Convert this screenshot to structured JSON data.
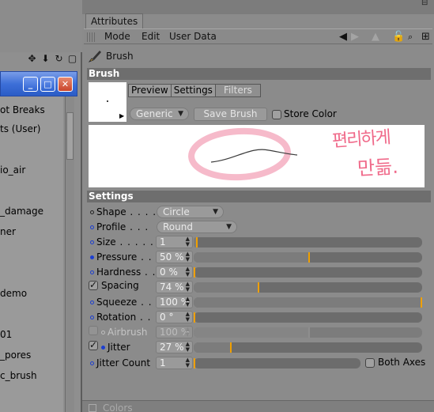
{
  "left_panel": {
    "icons": [
      "move-icon",
      "arrow-down-icon",
      "refresh-icon",
      "window-icon"
    ],
    "items": [
      "ot Breaks",
      "ts (User)",
      "io_air",
      "_damage",
      "ner",
      "demo",
      "01",
      "_pores",
      "c_brush"
    ]
  },
  "floating_window": {
    "minimize": "_",
    "maximize": "□",
    "close": "✕"
  },
  "attributes": {
    "tab_title": "Attributes",
    "menu": {
      "mode": "Mode",
      "edit": "Edit",
      "user_data": "User Data"
    },
    "brush_title": "Brush",
    "brush_section": "Brush",
    "subtabs": {
      "preview": "Preview",
      "settings": "Settings",
      "filters": "Filters"
    },
    "preset_dropdown": "Generic",
    "save_brush": "Save Brush",
    "store_color": "Store Color",
    "annotation_text_line1": "편리하게",
    "annotation_text_line2": "만듦.",
    "settings_section": "Settings",
    "params": {
      "shape": {
        "label": "Shape",
        "value": "Circle"
      },
      "profile": {
        "label": "Profile",
        "value": "Round"
      },
      "size": {
        "label": "Size",
        "value": "1",
        "level": 0.01
      },
      "pressure": {
        "label": "Pressure",
        "value": "50 %",
        "level": 0.5
      },
      "hardness": {
        "label": "Hardness",
        "value": "0 %",
        "level": 0.0
      },
      "spacing": {
        "label": "Spacing",
        "value": "74 %",
        "level": 0.28
      },
      "squeeze": {
        "label": "Squeeze",
        "value": "100 %",
        "level": 1.0
      },
      "rotation": {
        "label": "Rotation",
        "value": "0 °",
        "level": 0.0
      },
      "airbrush": {
        "label": "Airbrush",
        "value": "100 %",
        "level": 0.5
      },
      "jitter": {
        "label": "Jitter",
        "value": "27 %",
        "level": 0.16
      },
      "jitter_count": {
        "label": "Jitter Count",
        "value": "1",
        "level": 0.0
      }
    },
    "both_axes": "Both Axes",
    "colors_section": "Colors"
  },
  "colors": {
    "accent_knob": "#f0a000",
    "dot_blue": "#1d3fd0",
    "annotation_pink": "#f06a8a"
  }
}
